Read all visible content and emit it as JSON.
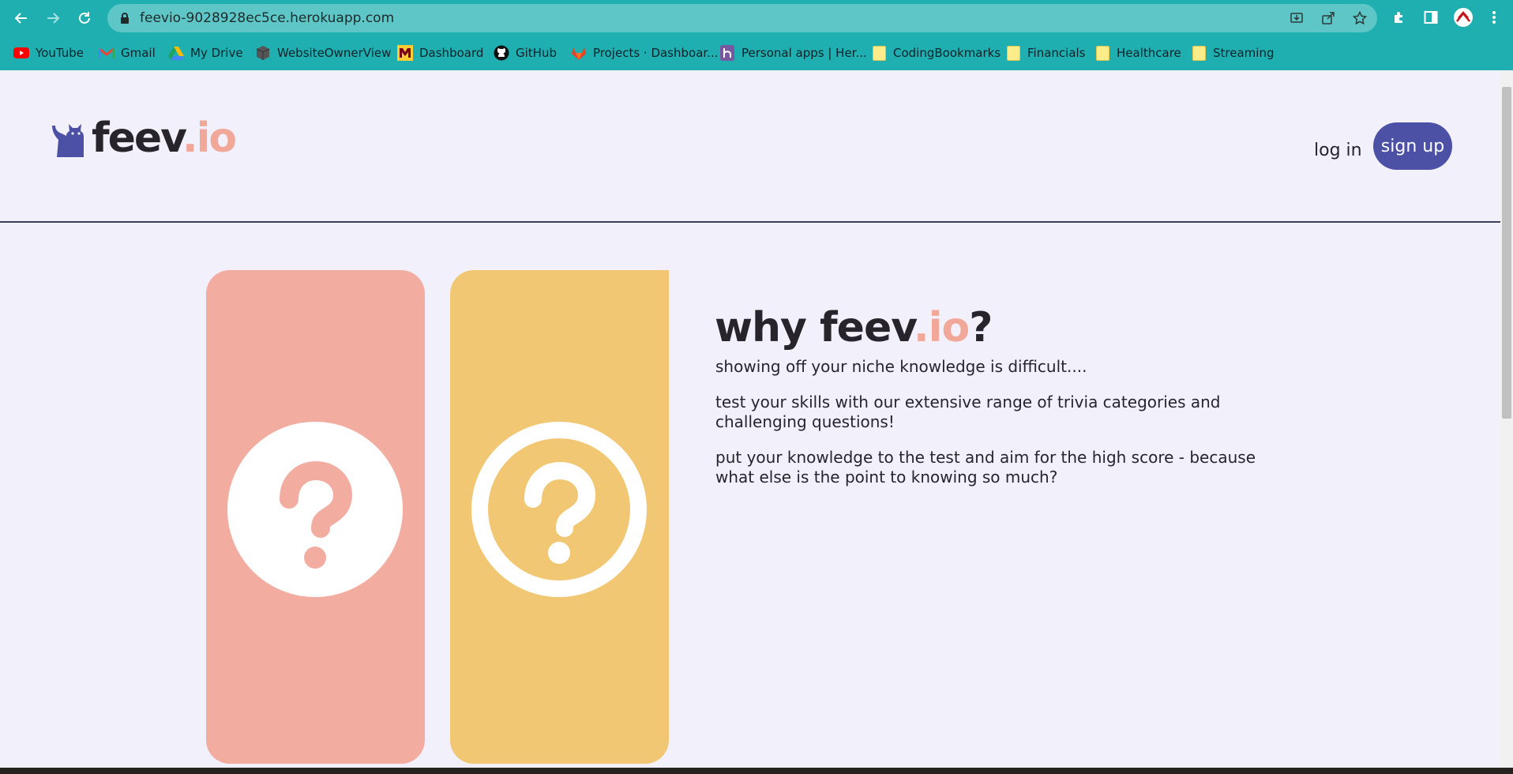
{
  "browser": {
    "url": "feevio-9028928ec5ce.herokuapp.com",
    "bookmarks": [
      {
        "label": "YouTube",
        "icon": "youtube-icon"
      },
      {
        "label": "Gmail",
        "icon": "gmail-icon"
      },
      {
        "label": "My Drive",
        "icon": "google-drive-icon"
      },
      {
        "label": "WebsiteOwnerView",
        "icon": "cube-icon"
      },
      {
        "label": "Dashboard",
        "icon": "university-m-icon"
      },
      {
        "label": "GitHub",
        "icon": "github-icon"
      },
      {
        "label": "Projects · Dashboar...",
        "icon": "gitlab-icon"
      },
      {
        "label": "Personal apps | Her...",
        "icon": "heroku-icon"
      },
      {
        "label": "CodingBookmarks",
        "icon": "folder-icon"
      },
      {
        "label": "Financials",
        "icon": "folder-icon"
      },
      {
        "label": "Healthcare",
        "icon": "folder-icon"
      },
      {
        "label": "Streaming",
        "icon": "folder-icon"
      }
    ]
  },
  "header": {
    "logo_main": "feev",
    "logo_accent": ".io",
    "login_label": "log in",
    "signup_label": "sign up"
  },
  "hero": {
    "title_main": "why feev",
    "title_accent": ".io",
    "title_end": "?",
    "paragraphs": [
      "showing off your niche knowledge is difficult....",
      "test your skills with our extensive range of trivia categories and challenging questions!",
      "put your knowledge to the test and aim for the high score - because what else is the point to knowing so much?"
    ]
  },
  "colors": {
    "chrome_teal": "#1fafb0",
    "page_bg": "#f1f0fb",
    "accent_pink": "#f3ada0",
    "accent_yellow": "#f2c774",
    "button_purple": "#4c51a6",
    "text_dark": "#27242c"
  }
}
